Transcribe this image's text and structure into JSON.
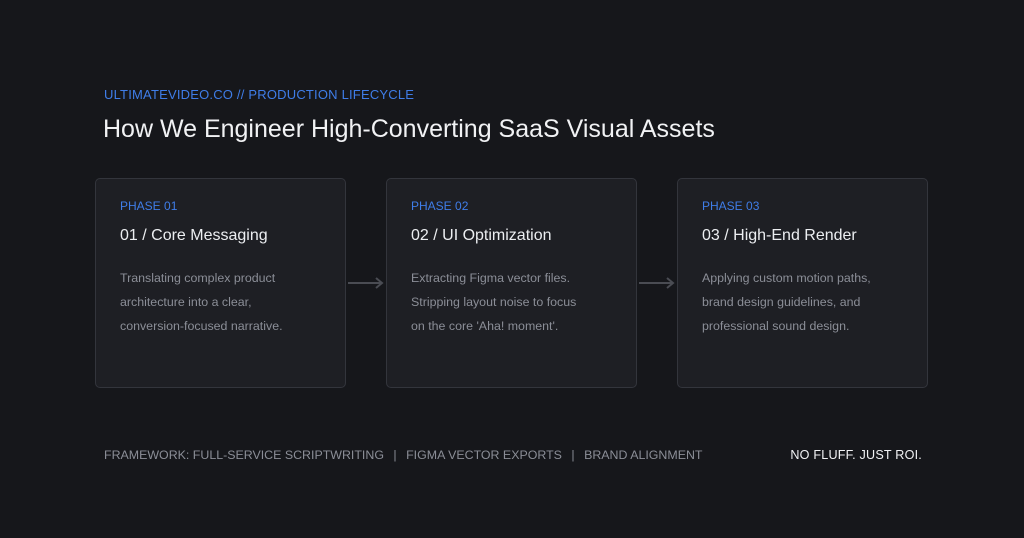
{
  "header": {
    "eyebrow": "ULTIMATEVIDEO.CO // PRODUCTION LIFECYCLE",
    "title": "How We Engineer High-Converting SaaS Visual Assets"
  },
  "phases": [
    {
      "label": "PHASE 01",
      "title": "01 / Core Messaging",
      "lines": [
        "Translating complex product",
        "architecture into a clear,",
        "conversion-focused narrative."
      ]
    },
    {
      "label": "PHASE 02",
      "title": "02 / UI Optimization",
      "lines": [
        "Extracting Figma vector files.",
        "Stripping layout noise to focus",
        "on the core 'Aha! moment'."
      ]
    },
    {
      "label": "PHASE 03",
      "title": "03 / High-End Render",
      "lines": [
        "Applying custom motion paths,",
        "brand design guidelines, and",
        "professional sound design."
      ]
    }
  ],
  "footer": {
    "framework_items": [
      "FRAMEWORK: FULL-SERVICE SCRIPTWRITING",
      "FIGMA VECTOR EXPORTS",
      "BRAND ALIGNMENT"
    ],
    "separator": "|",
    "tagline": "NO FLUFF. JUST ROI."
  },
  "colors": {
    "background": "#16171b",
    "card": "#1e1f24",
    "accent": "#3f7de8",
    "arrow": "#4a4c53"
  },
  "icons": [
    "arrow-right-icon"
  ]
}
